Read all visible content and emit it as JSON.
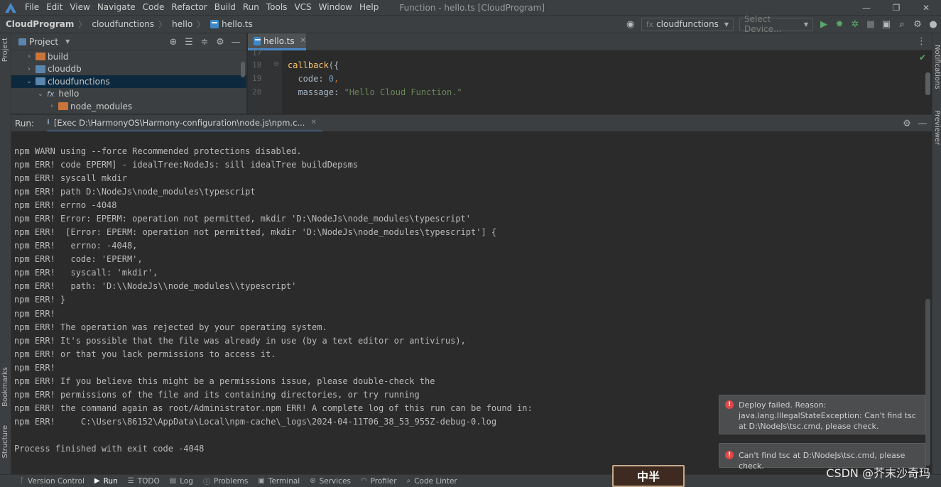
{
  "window": {
    "title": "Function - hello.ts [CloudProgram]",
    "menu": [
      "File",
      "Edit",
      "View",
      "Navigate",
      "Code",
      "Refactor",
      "Build",
      "Run",
      "Tools",
      "VCS",
      "Window",
      "Help"
    ]
  },
  "breadcrumb": [
    "CloudProgram",
    "cloudfunctions",
    "hello",
    "hello.ts"
  ],
  "toolbar": {
    "config_prefix": "fx",
    "config_name": "cloudfunctions",
    "device_placeholder": "Select Device..."
  },
  "side_tabs": {
    "project": "Project",
    "bookmarks": "Bookmarks",
    "structure": "Structure",
    "notifications": "Notifications",
    "previewer": "Previewer"
  },
  "project_panel": {
    "title": "Project",
    "tree": [
      {
        "label": "build",
        "type": "folder-orange",
        "depth": 1,
        "expanded": false
      },
      {
        "label": "clouddb",
        "type": "folder-blue",
        "depth": 1,
        "expanded": false
      },
      {
        "label": "cloudfunctions",
        "type": "folder-blue",
        "depth": 1,
        "expanded": true,
        "selected": true
      },
      {
        "label": "hello",
        "type": "function",
        "depth": 2,
        "expanded": true
      },
      {
        "label": "node_modules",
        "type": "folder-orange",
        "depth": 3,
        "expanded": false
      }
    ]
  },
  "editor": {
    "tab": "hello.ts",
    "lines": [
      {
        "num": "17",
        "code": ""
      },
      {
        "num": "18",
        "code": "callback({"
      },
      {
        "num": "19",
        "code": "  code: 0,"
      },
      {
        "num": "20",
        "code": "  massage: \"Hello Cloud Function.\""
      }
    ]
  },
  "run_panel": {
    "label": "Run:",
    "tab": "[Exec D:\\HarmonyOS\\Harmony-configuration\\node.js\\npm.c...",
    "console": [
      "npm WARN using --force Recommended protections disabled.",
      "npm ERR! code EPERM] - idealTree:NodeJs: sill idealTree buildDepsms",
      "npm ERR! syscall mkdir",
      "npm ERR! path D:\\NodeJs\\node_modules\\typescript",
      "npm ERR! errno -4048",
      "npm ERR! Error: EPERM: operation not permitted, mkdir 'D:\\NodeJs\\node_modules\\typescript'",
      "npm ERR!  [Error: EPERM: operation not permitted, mkdir 'D:\\NodeJs\\node_modules\\typescript'] {",
      "npm ERR!   errno: -4048,",
      "npm ERR!   code: 'EPERM',",
      "npm ERR!   syscall: 'mkdir',",
      "npm ERR!   path: 'D:\\\\NodeJs\\\\node_modules\\\\typescript'",
      "npm ERR! }",
      "npm ERR!",
      "npm ERR! The operation was rejected by your operating system.",
      "npm ERR! It's possible that the file was already in use (by a text editor or antivirus),",
      "npm ERR! or that you lack permissions to access it.",
      "npm ERR!",
      "npm ERR! If you believe this might be a permissions issue, please double-check the",
      "npm ERR! permissions of the file and its containing directories, or try running",
      "npm ERR! the command again as root/Administrator.npm ERR! A complete log of this run can be found in:",
      "npm ERR!     C:\\Users\\86152\\AppData\\Local\\npm-cache\\_logs\\2024-04-11T06_38_53_955Z-debug-0.log",
      "",
      "Process finished with exit code -4048"
    ]
  },
  "notifications": [
    {
      "lines": [
        "Deploy failed. Reason:",
        "java.lang.IllegalStateException: Can't find tsc",
        "at D:\\NodeJs\\tsc.cmd, please check."
      ]
    },
    {
      "lines": [
        "Can't find tsc at D:\\NodeJs\\tsc.cmd, please check."
      ]
    }
  ],
  "statusbar": [
    "Version Control",
    "Run",
    "TODO",
    "Log",
    "Problems",
    "Terminal",
    "Services",
    "Profiler",
    "Code Linter"
  ],
  "overlay": {
    "seal_text": "中半",
    "watermark": "CSDN @芥末沙奇玛"
  },
  "colors": {
    "accent": "#4a88c7",
    "error": "#e04848",
    "selection": "#0d293e",
    "run_green": "#59a869"
  }
}
